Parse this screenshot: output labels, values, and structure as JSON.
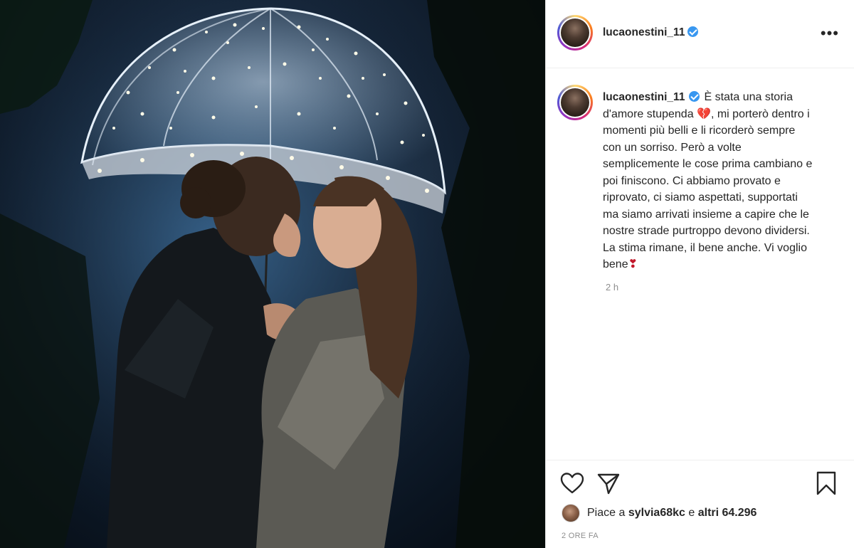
{
  "post": {
    "username": "lucaonestini_11",
    "verified": true,
    "caption": {
      "username": "lucaonestini_11",
      "text_1": "È stata una storia d'amore stupenda ",
      "emoji_1": "💔",
      "text_2": ", mi porterò dentro i momenti più belli e li ricorderò sempre con un sorriso. Però a volte semplicemente le cose prima cambiano e poi finiscono. Ci abbiamo provato e riprovato, ci siamo aspettati, supportati ma siamo arrivati insieme a capire che le nostre strade purtroppo devono dividersi. La stima rimane, il bene anche. Vi voglio bene",
      "emoji_2": "❣"
    },
    "caption_time": "2 h",
    "likes": {
      "prefix": "Piace a ",
      "liked_by": "sylvia68kc",
      "middle": " e ",
      "others": "altri 64.296"
    },
    "posted_ago": "2 ORE FA"
  },
  "icons": {
    "more": "more-options-icon",
    "like": "heart-icon",
    "share": "paper-plane-icon",
    "save": "bookmark-icon"
  },
  "colors": {
    "verified_blue": "#3897f0",
    "text": "#262626",
    "muted": "#8e8e8e"
  }
}
